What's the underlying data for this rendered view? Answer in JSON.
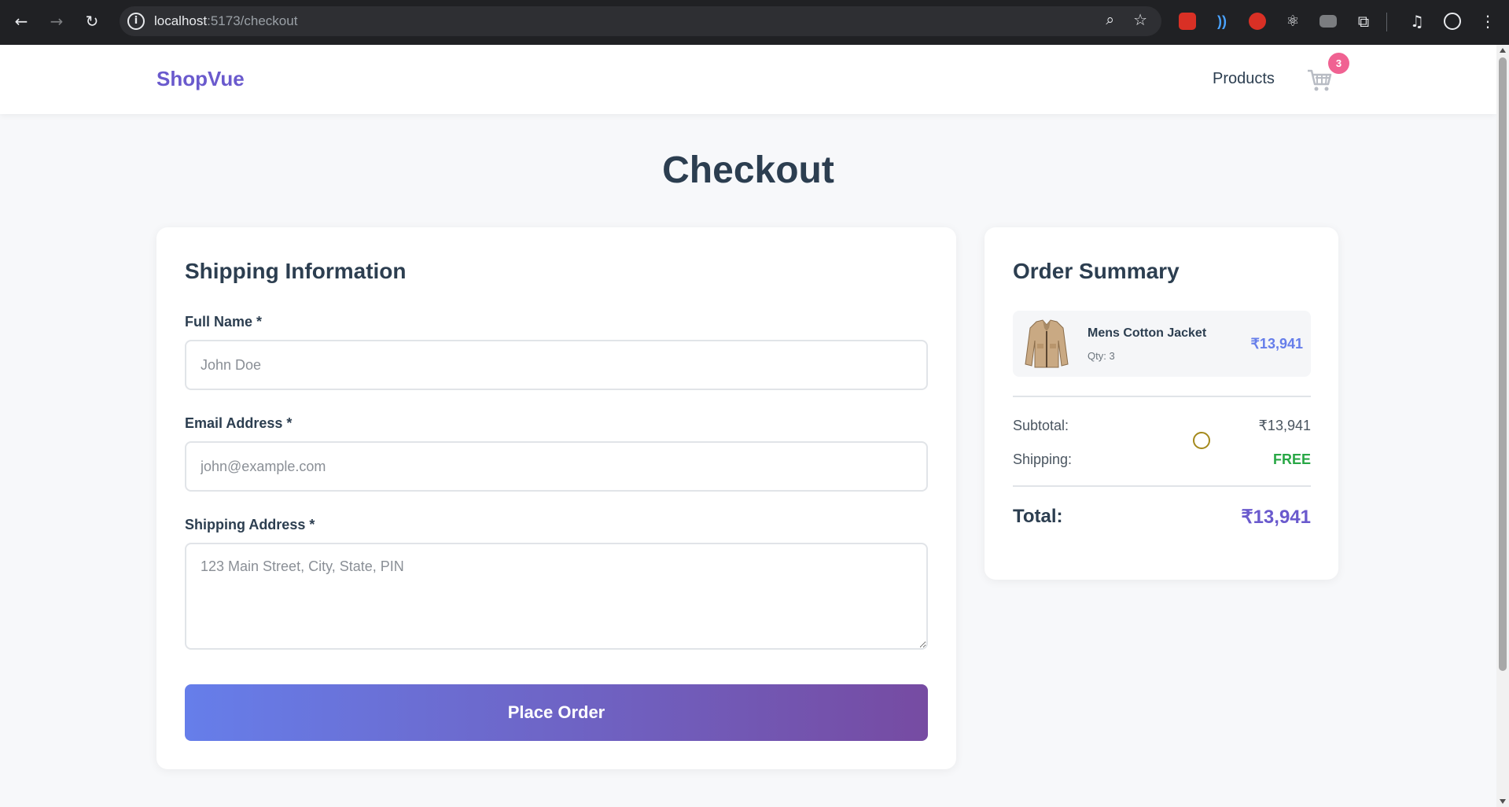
{
  "browser": {
    "url_host": "localhost",
    "url_path": ":5173/checkout",
    "icons": [
      "back-icon",
      "forward-icon",
      "reload-icon",
      "info-icon",
      "zoom-icon",
      "star-icon",
      "extension-icons",
      "puzzle-icon",
      "media-icon",
      "profile-icon",
      "menu-icon"
    ]
  },
  "header": {
    "brand": "ShopVue",
    "nav_products": "Products",
    "cart_count": "3"
  },
  "page": {
    "title": "Checkout"
  },
  "shipping": {
    "title": "Shipping Information",
    "full_name_label": "Full Name *",
    "full_name_placeholder": "John Doe",
    "email_label": "Email Address *",
    "email_placeholder": "john@example.com",
    "address_label": "Shipping Address *",
    "address_placeholder": "123 Main Street, City, State, PIN",
    "submit_label": "Place Order"
  },
  "summary": {
    "title": "Order Summary",
    "items": [
      {
        "name": "Mens Cotton Jacket",
        "qty": "Qty: 3",
        "price": "₹13,941"
      }
    ],
    "subtotal_label": "Subtotal:",
    "subtotal_value": "₹13,941",
    "shipping_label": "Shipping:",
    "shipping_value": "FREE",
    "total_label": "Total:",
    "total_value": "₹13,941"
  },
  "colors": {
    "brand": "#6a5acd",
    "accent_start": "#667eea",
    "accent_end": "#764ba2",
    "badge": "#f06292",
    "free": "#28a745"
  }
}
